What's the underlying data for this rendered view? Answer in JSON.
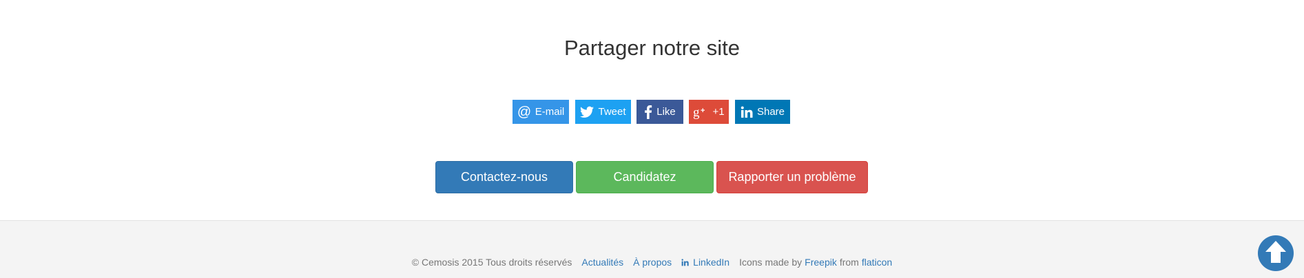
{
  "share": {
    "title": "Partager notre site",
    "buttons": [
      {
        "label": "E-mail",
        "icon": "at-icon",
        "color": "#3595e8"
      },
      {
        "label": "Tweet",
        "icon": "twitter-icon",
        "color": "#1da1f2"
      },
      {
        "label": "Like",
        "icon": "facebook-icon",
        "color": "#3b5998"
      },
      {
        "label": "+1",
        "icon": "google-plus-icon",
        "color": "#dd4b39"
      },
      {
        "label": "Share",
        "icon": "linkedin-icon",
        "color": "#0077b5"
      }
    ]
  },
  "actions": {
    "contact": {
      "label": "Contactez-nous",
      "color": "#337ab7"
    },
    "apply": {
      "label": "Candidatez",
      "color": "#5cb85c"
    },
    "report": {
      "label": "Rapporter un problème",
      "color": "#d9534f"
    }
  },
  "footer": {
    "copyright": "© Cemosis 2015 Tous droits réservés",
    "links": {
      "news": "Actualités",
      "about": "À propos",
      "linkedin": "LinkedIn"
    },
    "credits": {
      "prefix": "Icons made by",
      "author": "Freepik",
      "middle": "from",
      "source": "flaticon"
    }
  },
  "scroll_top": {
    "icon": "arrow-up-icon",
    "color": "#337ab7"
  }
}
